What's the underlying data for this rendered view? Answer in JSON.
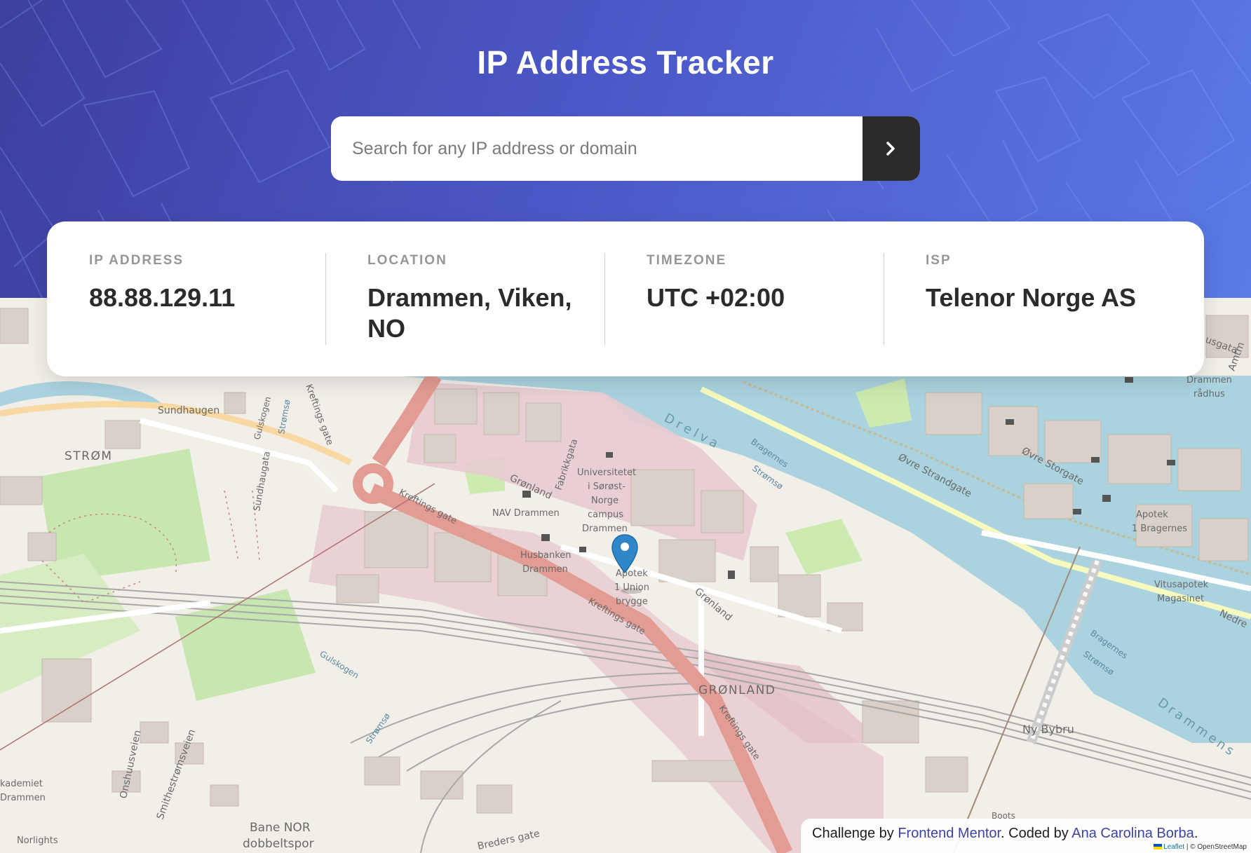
{
  "header": {
    "title": "IP Address Tracker"
  },
  "search": {
    "placeholder": "Search for any IP address or domain",
    "value": "",
    "submit_icon": "chevron-right-icon"
  },
  "info": [
    {
      "label": "IP ADDRESS",
      "value": "88.88.129.11"
    },
    {
      "label": "LOCATION",
      "value": "Drammen, Viken, NO"
    },
    {
      "label": "TIMEZONE",
      "value": "UTC +02:00"
    },
    {
      "label": "ISP",
      "value": "Telenor Norge AS"
    }
  ],
  "map": {
    "marker_icon": "location-pin-icon",
    "labels": {
      "strom": "STRØM",
      "sundhaugen": "Sundhaugen",
      "gronland_district": "GRØNLAND",
      "gronland_street": "Grønland",
      "gronland_street2": "Grønland",
      "kreftings_gate_1": "Kreftings gate",
      "kreftings_gate_2": "Kreftings gate",
      "kreftings_gate_3": "Kreftings gate",
      "kreftings_gate_4": "Kreftings gate",
      "fabrikkgata": "Fabrikkgata",
      "nav": "NAV Drammen",
      "husbanken_1": "Husbanken",
      "husbanken_2": "Drammen",
      "univ_1": "Universitetet",
      "univ_2": "i Sørøst-",
      "univ_3": "Norge",
      "univ_4": "campus",
      "univ_5": "Drammen",
      "apotek_1": "Apotek",
      "apotek_2": "1 Union",
      "apotek_3": "brygge",
      "drelva": "Drelva",
      "bragernes_1": "Bragernes",
      "stromso_1": "Strømsø",
      "bragernes_2": "Bragernes",
      "stromso_2": "Strømsø",
      "ovre_strandgate": "Øvre Strandgate",
      "ovre_storgate": "Øvre Storgate",
      "apotek_bragernes_1": "Apotek",
      "apotek_bragernes_2": "1 Bragernes",
      "vitusapotek_1": "Vitusapotek",
      "vitusapotek_2": "Magasinet",
      "drammen_radhus_1": "Drammen",
      "drammen_radhus_2": "rådhus",
      "ny_bybru": "Ny Bybru",
      "drammens": "Drammens",
      "nedre": "Nedre",
      "gulskogen": "Gulskogen",
      "gulskogen_2": "Gulskogen",
      "stromso_3": "Strømsø",
      "stromso_4": "Strømsø",
      "sundhaugata": "Sundhaugata",
      "onshuusveien": "Onshuusveien",
      "smithestromsveien": "Smithestrømsveien",
      "akademiet_1": "kademiet",
      "akademiet_2": "Drammen",
      "norlights": "Norlights",
      "bane_nor_1": "Bane NOR",
      "bane_nor_2": "dobbeltspor",
      "breders_gate": "Breders gate",
      "boots": "Boots",
      "usgata": "usgata",
      "amtm": "Amtm"
    }
  },
  "attribution": {
    "prefix": "Challenge by ",
    "frontend_mentor": "Frontend Mentor",
    "middle": ". Coded by ",
    "author": "Ana Carolina Borba",
    "suffix": ".",
    "leaflet": "Leaflet",
    "osm": " | © OpenStreetMap"
  }
}
